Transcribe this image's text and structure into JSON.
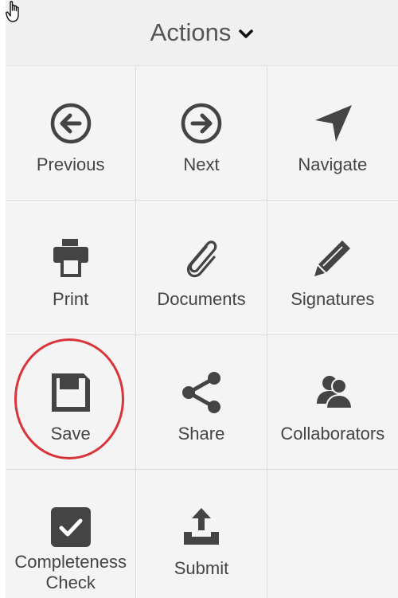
{
  "header": {
    "title": "Actions",
    "dropdown_icon": "chevron-down-icon"
  },
  "cursor": {
    "icon": "hand-pointer-icon"
  },
  "colors": {
    "icon": "#444444",
    "label": "#444444",
    "background": "#f4f4f4",
    "highlight": "#d9343a"
  },
  "actions": [
    {
      "label": "Previous",
      "icon": "arrow-left-circle-icon"
    },
    {
      "label": "Next",
      "icon": "arrow-right-circle-icon"
    },
    {
      "label": "Navigate",
      "icon": "location-arrow-icon"
    },
    {
      "label": "Print",
      "icon": "printer-icon"
    },
    {
      "label": "Documents",
      "icon": "paperclip-icon"
    },
    {
      "label": "Signatures",
      "icon": "pencil-icon"
    },
    {
      "label": "Save",
      "icon": "floppy-disk-icon",
      "highlighted": true
    },
    {
      "label": "Share",
      "icon": "share-icon"
    },
    {
      "label": "Collaborators",
      "icon": "users-icon"
    },
    {
      "label": "Completeness Check",
      "label_line1": "Completeness",
      "label_line2": "Check",
      "icon": "checkbox-icon"
    },
    {
      "label": "Submit",
      "icon": "upload-icon"
    }
  ]
}
